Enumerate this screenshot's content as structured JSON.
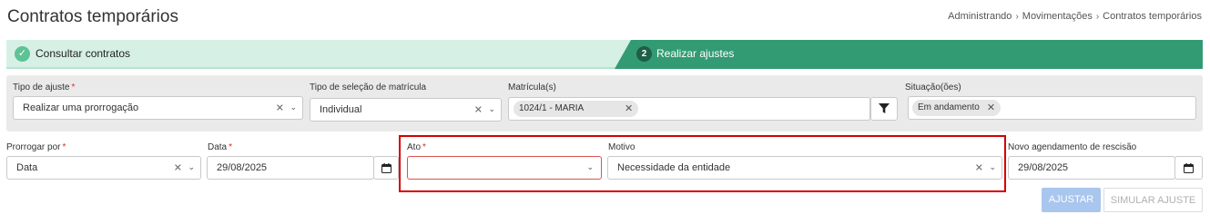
{
  "page": {
    "title": "Contratos temporários"
  },
  "breadcrumb": [
    "Administrando",
    "Movimentações",
    "Contratos temporários"
  ],
  "steps": [
    {
      "label": "Consultar contratos",
      "icon": "check-icon"
    },
    {
      "number": "2",
      "label": "Realizar ajustes"
    }
  ],
  "filters": {
    "tipo_ajuste": {
      "label": "Tipo de ajuste",
      "required": "*",
      "value": "Realizar uma prorrogação"
    },
    "tipo_selecao": {
      "label": "Tipo de seleção de matrícula",
      "value": "Individual"
    },
    "matriculas": {
      "label": "Matrícula(s)",
      "chip": "1024/1 - MARIA"
    },
    "situacoes": {
      "label": "Situação(ões)",
      "chip": "Em andamento"
    }
  },
  "form": {
    "prorrogar_por": {
      "label": "Prorrogar por",
      "required": "*",
      "value": "Data"
    },
    "data": {
      "label": "Data",
      "required": "*",
      "value": "29/08/2025"
    },
    "ato": {
      "label": "Ato",
      "required": "*",
      "value": ""
    },
    "motivo": {
      "label": "Motivo",
      "value": "Necessidade da entidade"
    },
    "novo_agendamento": {
      "label": "Novo agendamento de rescisão",
      "value": "29/08/2025"
    }
  },
  "actions": {
    "ajustar": "AJUSTAR",
    "simular": "SIMULAR AJUSTE"
  },
  "colors": {
    "step_done_bg": "#d6f0e6",
    "step_active_bg": "#339b73",
    "highlight": "#d40000",
    "required": "#d32f2f",
    "primary_disabled": "#a9c6ee"
  }
}
